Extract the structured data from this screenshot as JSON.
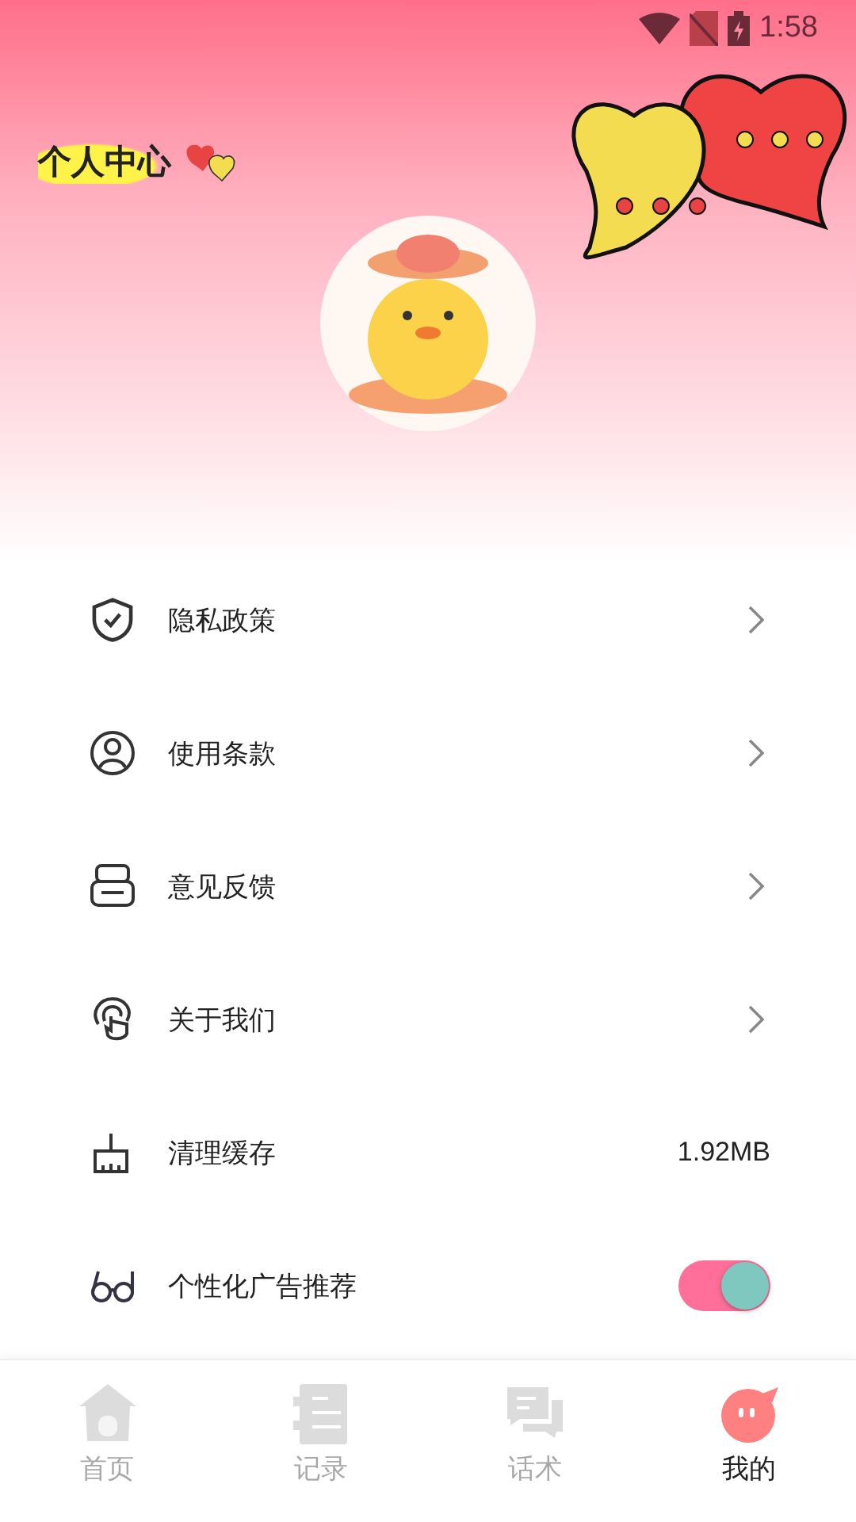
{
  "status_bar": {
    "time": "1:58"
  },
  "header": {
    "title": "个人中心"
  },
  "menu": [
    {
      "kind": "link",
      "label": "隐私政策"
    },
    {
      "kind": "link",
      "label": "使用条款"
    },
    {
      "kind": "link",
      "label": "意见反馈"
    },
    {
      "kind": "link",
      "label": "关于我们"
    },
    {
      "kind": "value",
      "label": "清理缓存",
      "value": "1.92MB"
    },
    {
      "kind": "toggle",
      "label": "个性化广告推荐",
      "on": true
    }
  ],
  "tabs": [
    {
      "label": "首页",
      "selected": false
    },
    {
      "label": "记录",
      "selected": false
    },
    {
      "label": "话术",
      "selected": false
    },
    {
      "label": "我的",
      "selected": true
    }
  ]
}
